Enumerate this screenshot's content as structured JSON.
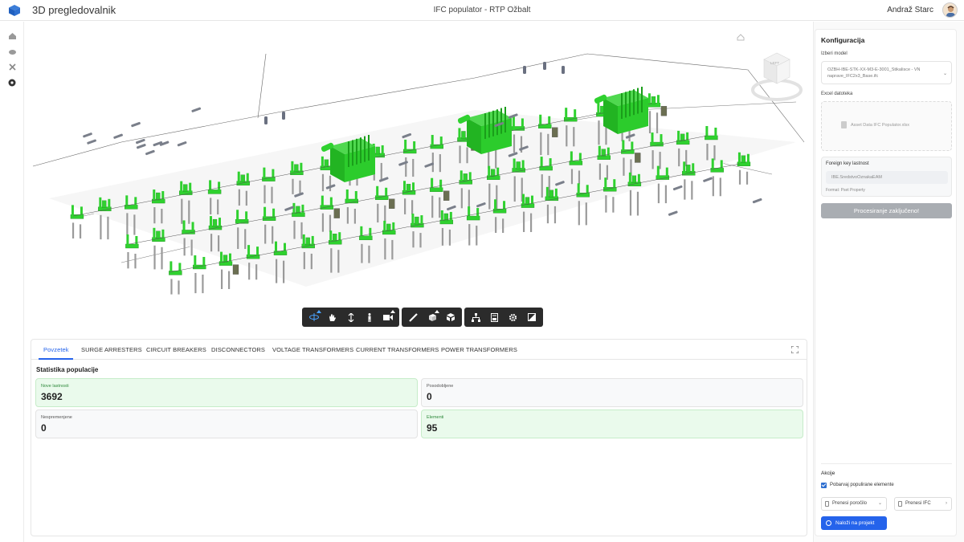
{
  "header": {
    "app_title": "3D pregledovalnik",
    "center_title": "IFC populator - RTP Ožbalt",
    "user_name": "Andraž Starc"
  },
  "viewer": {
    "navcube_label": "LEFT",
    "model_color": "#2fd12f"
  },
  "tabs": [
    {
      "label": "Povzetek",
      "active": true
    },
    {
      "label": "SURGE ARRESTERS"
    },
    {
      "label": "CIRCUIT BREAKERS"
    },
    {
      "label": "DISCONNECTORS"
    },
    {
      "label": "VOLTAGE TRANSFORMERS"
    },
    {
      "label": "CURRENT TRANSFORMERS"
    },
    {
      "label": "POWER TRANSFORMERS"
    }
  ],
  "stats": {
    "heading": "Statistika populacije",
    "cards": [
      {
        "label": "Nove lastnosti",
        "value": "3692"
      },
      {
        "label": "Posodobljene",
        "value": "0"
      },
      {
        "label": "Nespremenjene",
        "value": "0"
      },
      {
        "label": "Elementi",
        "value": "95"
      }
    ]
  },
  "config": {
    "title": "Konfiguracija",
    "model_label": "Izberi model",
    "model_value": "OZBH-IBE-STK-XX-M3-E-3001_Stikalisce - VN naprave_IFC2x3_Base.ifc",
    "excel_label": "Excel datoteka",
    "excel_file": "Asset Data IFC Populator.xlsx",
    "fk_label": "Foreign key lastnost",
    "fk_value": "IBE.SredstvoOznakaEAM",
    "fk_format": "Format: Pset Property",
    "process_button": "Procesiranje zaključeno!"
  },
  "actions": {
    "title": "Akcije",
    "checkbox_label": "Pobarvaj populirane elemente",
    "download_report": "Prenesi poročilo",
    "download_ifc": "Prenesi IFC",
    "upload_project": "Naloži na projekt"
  }
}
